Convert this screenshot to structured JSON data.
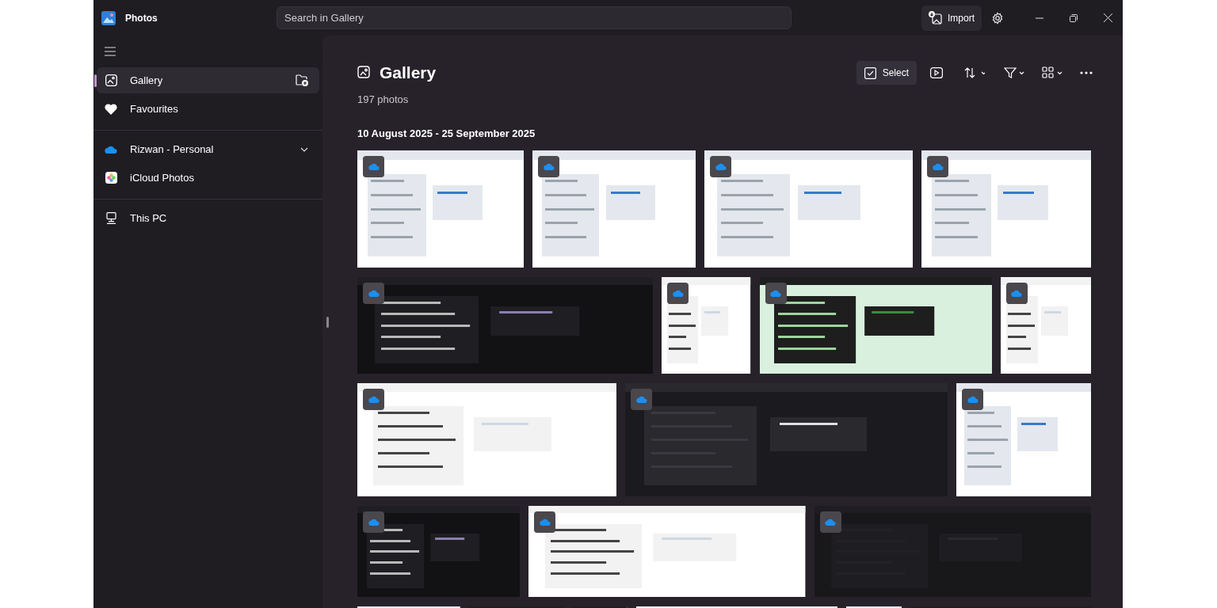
{
  "app": {
    "title": "Photos"
  },
  "search": {
    "placeholder": "Search in Gallery"
  },
  "import_button": {
    "label": "Import"
  },
  "sidebar": {
    "items": [
      {
        "kind": "gallery",
        "label": "Gallery",
        "selected": true
      },
      {
        "kind": "favourites",
        "label": "Favourites",
        "selected": false
      },
      {
        "kind": "onedrive",
        "label": "Rizwan - Personal",
        "selected": false,
        "expanded": false
      },
      {
        "kind": "icloud",
        "label": "iCloud Photos",
        "selected": false
      },
      {
        "kind": "pc",
        "label": "This PC",
        "selected": false
      }
    ]
  },
  "header": {
    "title": "Gallery",
    "count": "197 photos",
    "select_label": "Select"
  },
  "section": {
    "date_range": "10 August 2025 - 25 September 2025"
  },
  "rows": [
    {
      "photos": [
        {
          "kind": "picture",
          "synced": true
        },
        {
          "kind": "picture",
          "synced": true
        },
        {
          "kind": "picture",
          "synced": true
        },
        {
          "kind": "picture",
          "synced": true
        }
      ]
    },
    {
      "photos": [
        {
          "kind": "picture",
          "synced": true
        },
        {
          "kind": "picture",
          "synced": true
        },
        {
          "kind": "picture",
          "synced": true
        },
        {
          "kind": "picture",
          "synced": true
        }
      ]
    },
    {
      "photos": [
        {
          "kind": "picture",
          "synced": true
        },
        {
          "kind": "picture",
          "synced": true
        },
        {
          "kind": "picture",
          "synced": true
        }
      ]
    },
    {
      "photos": [
        {
          "kind": "picture",
          "synced": true
        },
        {
          "kind": "picture",
          "synced": true
        },
        {
          "kind": "picture",
          "synced": true
        }
      ]
    },
    {
      "photos": [
        {
          "kind": "picture"
        },
        {
          "kind": "picture"
        },
        {
          "kind": "picture"
        },
        {
          "kind": "picture"
        },
        {
          "kind": "picture"
        },
        {
          "kind": "picture"
        }
      ]
    }
  ]
}
